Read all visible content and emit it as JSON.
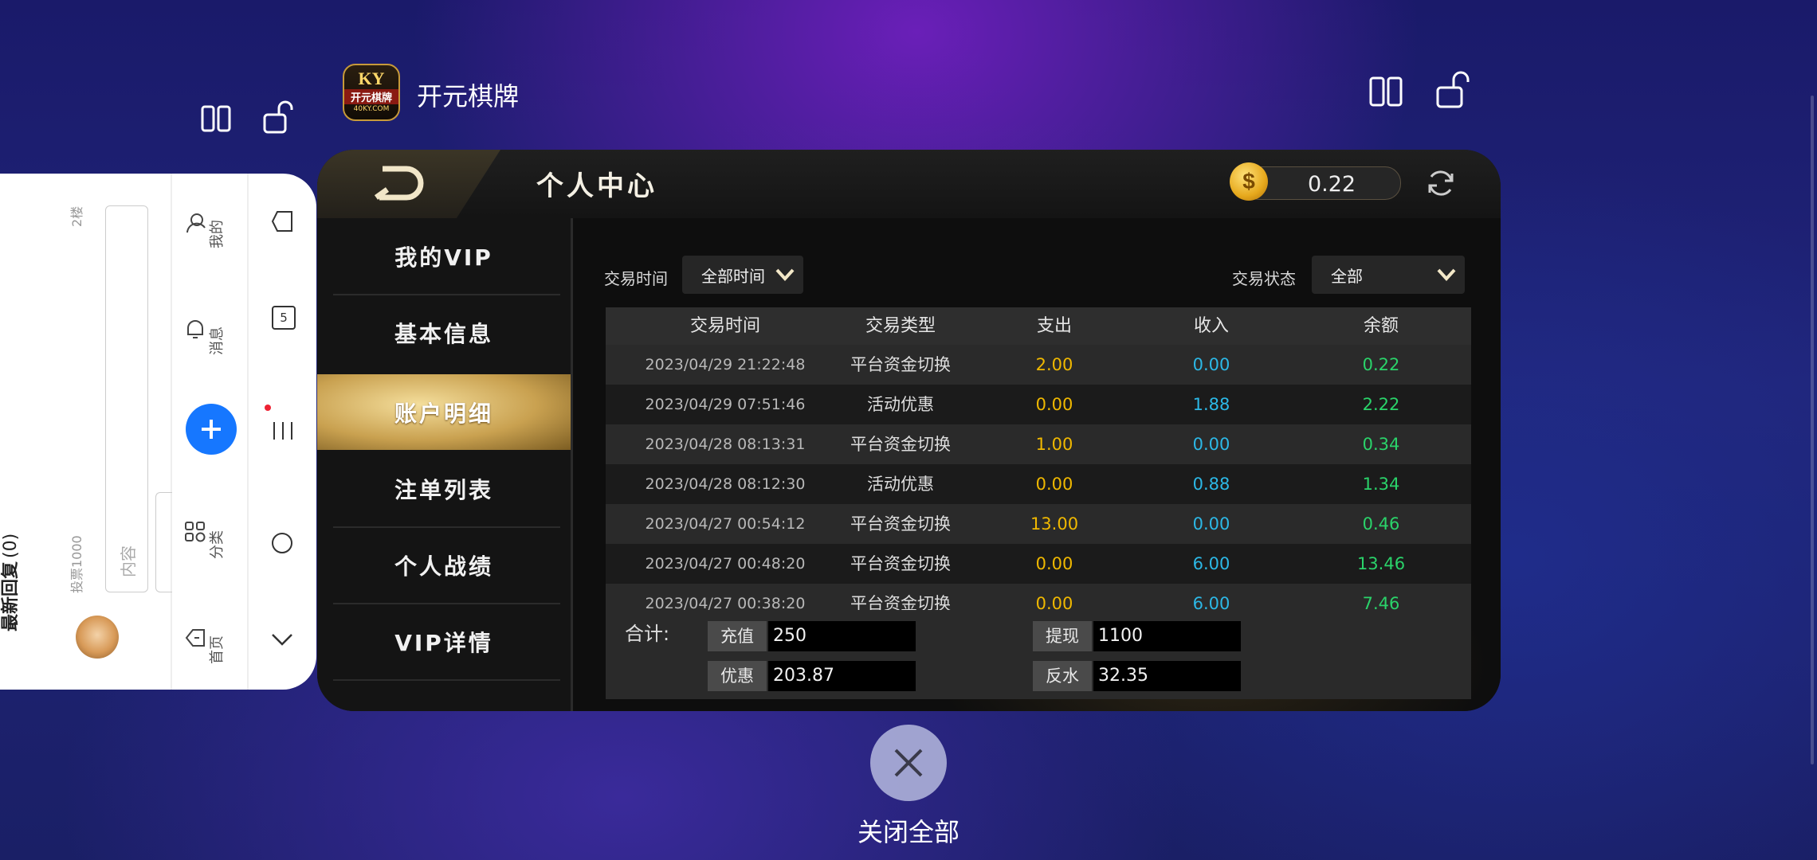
{
  "recents_overlay": {
    "app_title": "开元棋牌",
    "close_all_label": "关闭全部"
  },
  "left_app": {
    "reply_title": "最新回复",
    "reply_count": "(0)",
    "floor_label": "2楼",
    "vote_label": "投票1000",
    "content_placeholder": "内容",
    "tabs": [
      {
        "label": "我的",
        "icon": "person-icon"
      },
      {
        "label": "消息",
        "icon": "bell-icon"
      },
      {
        "label": "",
        "icon": "plus-icon"
      },
      {
        "label": "分类",
        "icon": "grid-icon"
      },
      {
        "label": "首页",
        "icon": "home-icon"
      }
    ],
    "nav_badge": "5"
  },
  "game": {
    "page_title": "个人中心",
    "balance": "0.22",
    "menu": [
      {
        "label": "我的VIP",
        "active": false
      },
      {
        "label": "基本信息",
        "active": false
      },
      {
        "label": "账户明细",
        "active": true
      },
      {
        "label": "注单列表",
        "active": false
      },
      {
        "label": "个人战绩",
        "active": false
      },
      {
        "label": "VIP详情",
        "active": false
      }
    ],
    "filters": {
      "time_label": "交易时间",
      "time_value": "全部时间",
      "status_label": "交易状态",
      "status_value": "全部"
    },
    "table": {
      "headers": [
        "交易时间",
        "交易类型",
        "支出",
        "收入",
        "余额"
      ],
      "rows": [
        [
          "2023/04/29 21:22:48",
          "平台资金切换",
          "2.00",
          "0.00",
          "0.22"
        ],
        [
          "2023/04/29 07:51:46",
          "活动优惠",
          "0.00",
          "1.88",
          "2.22"
        ],
        [
          "2023/04/28 08:13:31",
          "平台资金切换",
          "1.00",
          "0.00",
          "0.34"
        ],
        [
          "2023/04/28 08:12:30",
          "活动优惠",
          "0.00",
          "0.88",
          "1.34"
        ],
        [
          "2023/04/27 00:54:12",
          "平台资金切换",
          "13.00",
          "0.00",
          "0.46"
        ],
        [
          "2023/04/27 00:48:20",
          "平台资金切换",
          "0.00",
          "6.00",
          "13.46"
        ],
        [
          "2023/04/27 00:38:20",
          "平台资金切换",
          "0.00",
          "6.00",
          "7.46"
        ]
      ]
    },
    "summary": {
      "label": "合计:",
      "recharge_key": "充值",
      "recharge_val": "250",
      "withdraw_key": "提现",
      "withdraw_val": "1100",
      "promo_key": "优惠",
      "promo_val": "203.87",
      "rebate_key": "反水",
      "rebate_val": "32.35"
    }
  },
  "colors": {
    "gold": "#c9a150",
    "expense": "#f0b800",
    "income": "#2cb8e6",
    "balance": "#2ad36a",
    "blue_button": "#1677ff"
  },
  "app_logo": {
    "text_top": "KY",
    "text_mid": "开元棋牌",
    "text_bottom": "40KY.COM"
  }
}
